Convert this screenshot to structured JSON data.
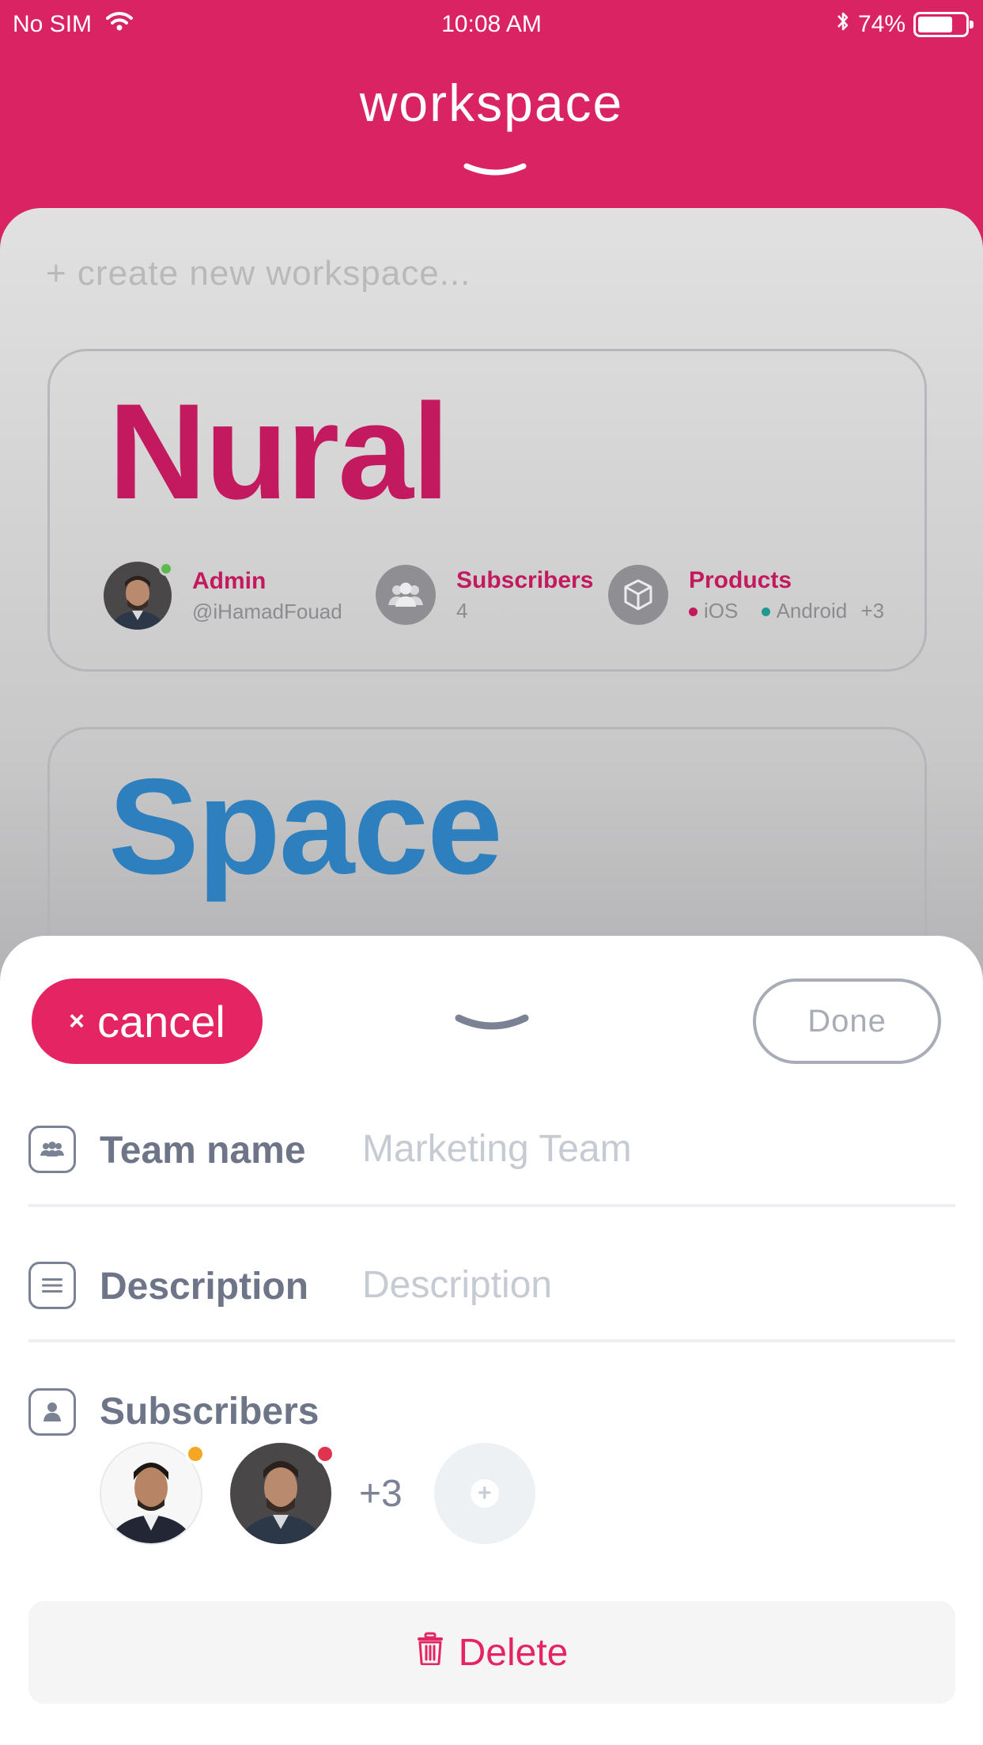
{
  "status_bar": {
    "carrier": "No SIM",
    "time": "10:08 AM",
    "battery_percent": "74%",
    "battery_level": 0.74,
    "icons": [
      "wifi-icon",
      "bluetooth-icon",
      "battery-icon"
    ]
  },
  "header": {
    "title": "workspace"
  },
  "workspace_list": {
    "create_label": "+ create new workspace...",
    "workspaces": [
      {
        "name": "Nural",
        "admin_label": "Admin",
        "admin_handle": "@iHamadFouad",
        "subscribers_label": "Subscribers",
        "subscribers_count": "4",
        "products_label": "Products",
        "product_1": "iOS",
        "product_2": "Android",
        "product_more": "+3"
      },
      {
        "name": "Space"
      }
    ]
  },
  "sheet": {
    "cancel_label": "cancel",
    "done_label": "Done",
    "team_name_label": "Team name",
    "team_name_placeholder": "Marketing Team",
    "description_label": "Description",
    "description_placeholder": "Description",
    "subscribers_label": "Subscribers",
    "subscribers_more": "+3",
    "delete_label": "Delete"
  },
  "colors": {
    "brand": "#d92363",
    "accent_button": "#e52563",
    "nural_title": "#c3195e",
    "space_title": "#2e7fbd",
    "label_gray": "#6e7588",
    "placeholder_gray": "#c6cad2",
    "status_online": "#5cb84f",
    "status_away": "#f5a623",
    "status_busy": "#e0334f",
    "ios_dot": "#c3195e",
    "android_dot": "#1f9a8f"
  }
}
